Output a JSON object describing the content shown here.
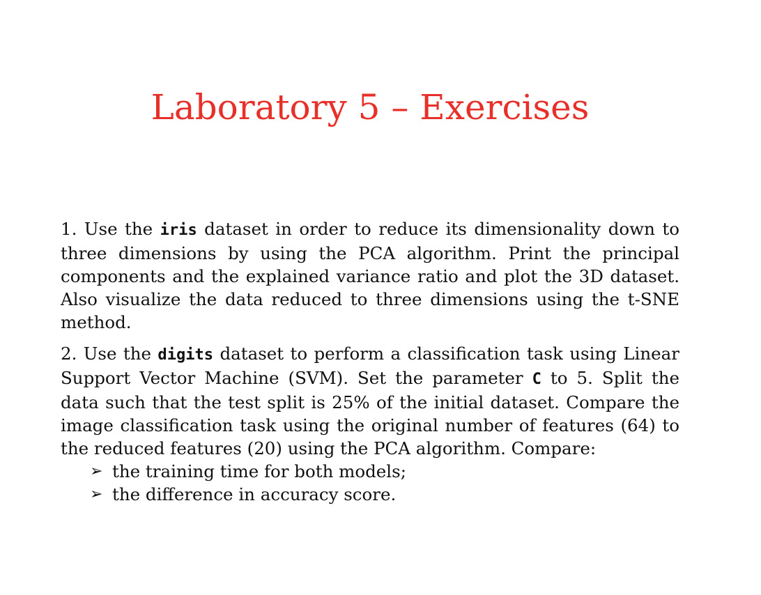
{
  "slide": {
    "title": "Laboratory 5 – Exercises",
    "title_color": "#e8302a",
    "exercises": [
      {
        "number": "1.",
        "text_1": " Use the ",
        "code_1": "iris",
        "text_2": " dataset in order to reduce its dimensionality down to three dimensions by using the PCA algorithm. Print the principal components and the explained variance ratio and plot the 3D dataset. Also visualize the data reduced to three dimensions using the t-SNE method."
      },
      {
        "number": "2.",
        "text_1": " Use the ",
        "code_1": "digits",
        "text_2": " dataset to perform a classification task using Linear Support Vector Machine (SVM). Set the parameter ",
        "code_2": "C",
        "text_3": " to 5. Split the data such that the test split is 25% of the initial dataset. Compare the image classification task using the original number of features (64) to the reduced features (20) using the PCA algorithm. Compare:",
        "bullets": [
          "the training time for both models;",
          "the difference in accuracy score."
        ],
        "bullet_icon": "arrowhead-bullet-icon"
      }
    ]
  }
}
